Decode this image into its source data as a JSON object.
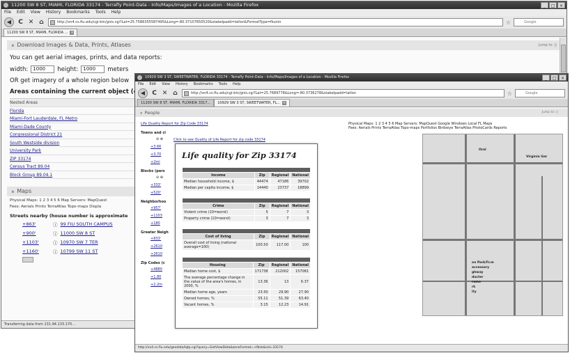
{
  "back_window": {
    "title": "11200 SW 8 ST, MIAMI, FLORIDA 33174 - Terrafly Point-Data - Info/Maps/Images of a Location - Mozilla Firefox",
    "menu": [
      "File",
      "Edit",
      "View",
      "History",
      "Bookmarks",
      "Tools",
      "Help"
    ],
    "url": "http://vn4.cs.fiu.edu/cgi-bin/gnis.cgi?Lat=25.7586355587495&Long=-80.37107650520&stabelpadd=latlon&FormatType=fkunin",
    "search_placeholder": "Google",
    "tab_label": "11200 SW 8 ST, MIAMI, FLORIDA ...",
    "download_header": "Download Images & Data, Prints, Atlases",
    "jump_to": "Jump to: ||",
    "aerial_text": "You can get aerial images, prints, and data reports:",
    "width_label": "width:",
    "width_value": "1000",
    "height_label": "height:",
    "height_value": "1000",
    "meters_label": "meters",
    "or_text": "OR get imagery of a whole region below",
    "areas_title": "Areas containing the current object (c",
    "areas_header": "Nested Areas",
    "areas": [
      "Florida",
      "Miami-Fort Lauderdale, FL Metro",
      "Miami-Dade County",
      "Congressional District 21",
      "South Westside division",
      "University Park",
      "ZIP 33174",
      "Census Tract 89.04",
      "Block Group 89.04.1"
    ],
    "maps_header": "Maps",
    "physical_maps": "Physical Maps: 1 2 3 4 5 6 Map Servers: MapQuest",
    "fees": "Fees: Aerials Prints TerraAtlas Topo-maps Displa",
    "streets_title": "Streets nearby (house number is approximate",
    "streets": [
      {
        "dist": "+863'",
        "name": "99 FIU SOUTH CAMPUS"
      },
      {
        "dist": "+900'",
        "name": "11000 SW 8 ST"
      },
      {
        "dist": "+1103'",
        "name": "10970 SW 7 TER"
      },
      {
        "dist": "+1160'",
        "name": "10799 SW 11 ST"
      }
    ],
    "status": "Transferring data from 131.94.133.170..."
  },
  "front_window": {
    "title": "10929 SW 3 ST, SWEETWATER, FLORIDA 33174 - Terrafly Point-Data - Info/Maps/Images of a Location - Mozilla Firefox",
    "menu": [
      "File",
      "Edit",
      "View",
      "History",
      "Bookmarks",
      "Tools",
      "Help"
    ],
    "url": "http://vn4.cs.fiu.edu/cgi-bin/gnis.cgi?Lat=25.7689778&Long=-80.3736278&stabelpadd=latlon",
    "search_placeholder": "Google",
    "tabs": [
      "11200 SW 8 ST, MIAMI, FLORIDA 3317...",
      "10929 SW 3 ST, SWEETWATER, FL..."
    ],
    "people_header": "People",
    "jump_to": "Jump to: ||",
    "lq_report_link": "Life Quality Report for Zip Code 33174",
    "click_hint": "Click to see Quality of Life Report for zip code 33174",
    "towns_heading": "Towns and ci",
    "towns": [
      "+3.66",
      "+3.70",
      "+2mi"
    ],
    "blocks_heading": "Blocks (pers",
    "blocks": [
      "+333'",
      "+520'"
    ],
    "neighborhoods_heading": "Neighborhoo",
    "neighborhoods": [
      "+957'",
      "+1103",
      "+180"
    ],
    "greater_heading": "Greater Neigh",
    "greater": [
      "+833'",
      "+2610",
      "+2610"
    ],
    "zip_heading": "Zip Codes (c",
    "zips": [
      "+4880",
      "+1.80",
      "+2.2m"
    ],
    "physical_maps": "Physical Maps: 1 2 3 4 5 6 Map Servers: MapQuest Google Windows Local FL Maps",
    "fees": "Fees: Aerials Prints TerraAtlas Topo-maps Portfolios Birdseye TerraAtlas PhotoCards Reports",
    "map_labels": [
      "Oral",
      "Virginia Gar",
      "on Park/Fr.m",
      "accessory",
      "ghway",
      "ducter",
      "rome",
      "rk",
      "ity"
    ],
    "status": "http://vn4.cs.fiu.edu/geodata/lqtp.cgi?query=GetViewData&zoneFormat=+fbnk&sid=33174"
  },
  "popup": {
    "title": "Life quality for Zip 33174",
    "col_zip": "Zip",
    "col_regional": "Regional",
    "col_national": "National",
    "income": {
      "header": "Income",
      "rows": [
        {
          "label": "Median household income, $",
          "zip": "44474",
          "regional": "47186",
          "national": "39702"
        },
        {
          "label": "Median per capita income, $",
          "zip": "14440",
          "regional": "23737",
          "national": "18899"
        }
      ]
    },
    "crime": {
      "header": "Crime",
      "rows": [
        {
          "label": "Violent crime (10=worst)",
          "zip": "5",
          "regional": "7",
          "national": "3"
        },
        {
          "label": "Property crime (10=worst)",
          "zip": "3",
          "regional": "7",
          "national": "3"
        }
      ]
    },
    "cost": {
      "header": "Cost of living",
      "rows": [
        {
          "label": "Overall cost of living (national average=100)",
          "zip": "100.50",
          "regional": "117.00",
          "national": "100"
        }
      ]
    },
    "housing": {
      "header": "Housing",
      "rows": [
        {
          "label": "Median home cost, $",
          "zip": "171738",
          "regional": "212002",
          "national": "157081"
        },
        {
          "label": "The average percentage change in the value of the area's homes, in 2000, %",
          "zip": "13.36",
          "regional": "13",
          "national": "6.37"
        },
        {
          "label": "Median home age, years",
          "zip": "23.50",
          "regional": "29.90",
          "national": "27.90"
        },
        {
          "label": "Owned homes, %",
          "zip": "55.11",
          "regional": "51.39",
          "national": "63.40"
        },
        {
          "label": "Vacant homes, %",
          "zip": "3.15",
          "regional": "12.23",
          "national": "14.91"
        }
      ]
    }
  }
}
